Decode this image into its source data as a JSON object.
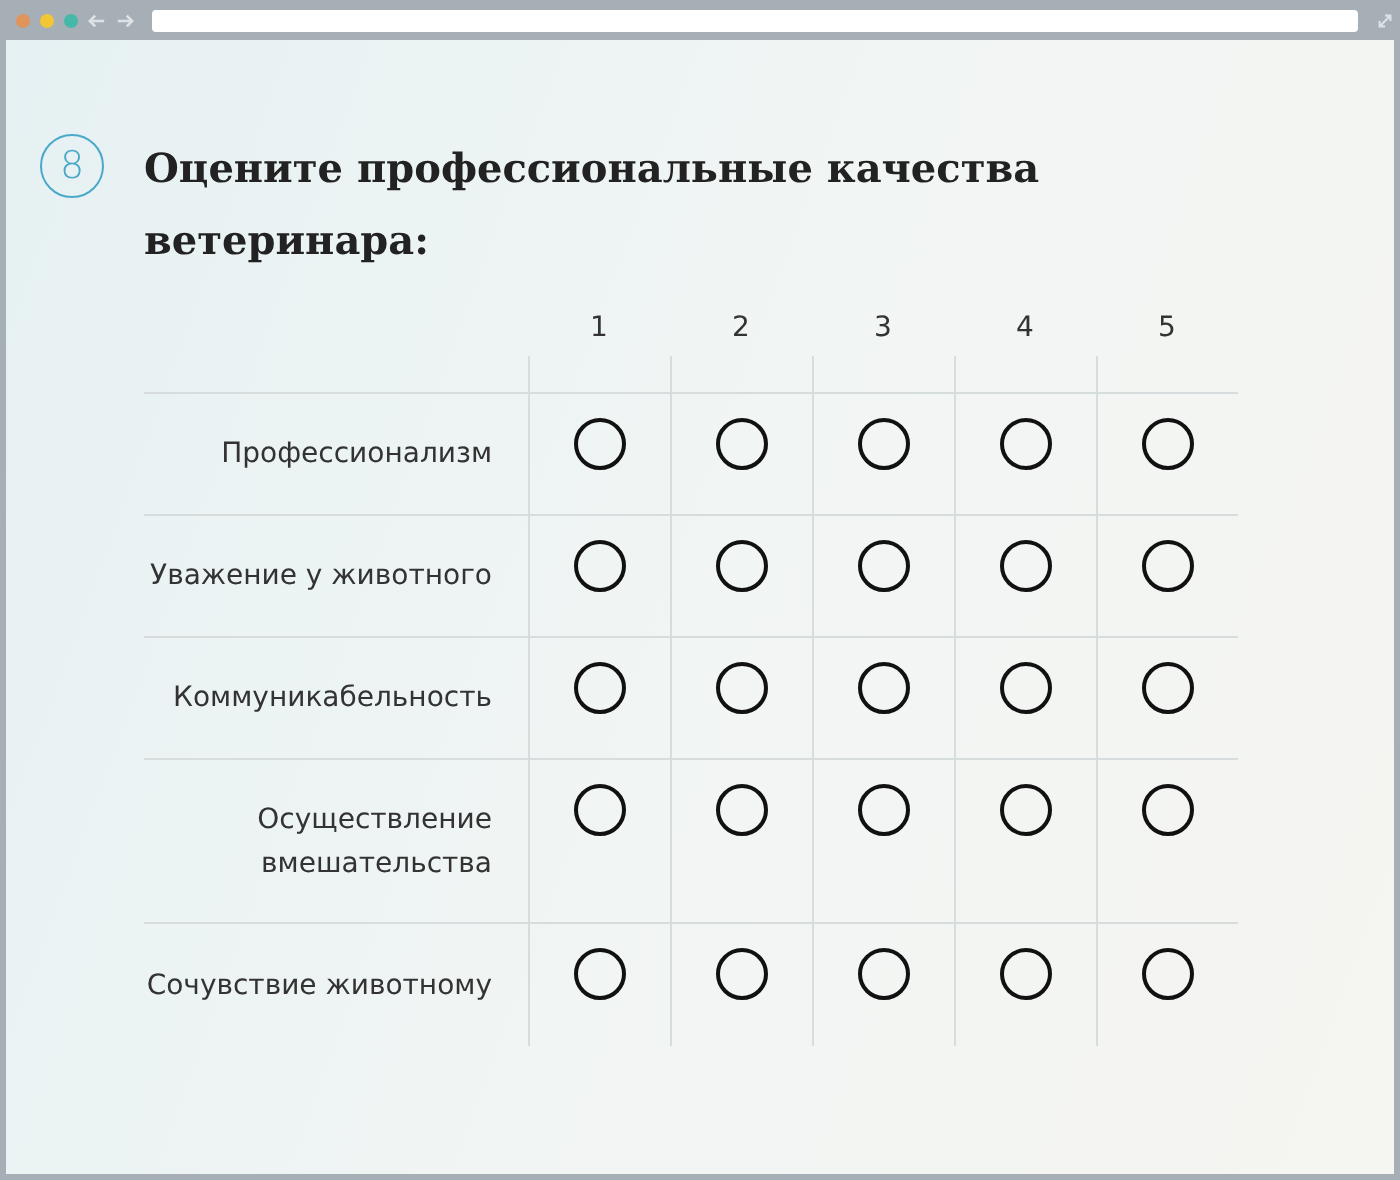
{
  "question": {
    "number": "8",
    "title": "Оцените профессиональные качества ветеринара:"
  },
  "scale": [
    "1",
    "2",
    "3",
    "4",
    "5"
  ],
  "rows": [
    {
      "label": "Профессионализм",
      "options": [
        {
          "selected": false
        },
        {
          "selected": false
        },
        {
          "selected": false
        },
        {
          "selected": false
        },
        {
          "selected": false
        }
      ]
    },
    {
      "label": "Уважение у животного",
      "options": [
        {
          "selected": false
        },
        {
          "selected": false
        },
        {
          "selected": false
        },
        {
          "selected": false
        },
        {
          "selected": false
        }
      ]
    },
    {
      "label": "Коммуникабельность",
      "options": [
        {
          "selected": false
        },
        {
          "selected": false
        },
        {
          "selected": false
        },
        {
          "selected": false
        },
        {
          "selected": false
        }
      ]
    },
    {
      "label": "Осуществление вмешательства",
      "options": [
        {
          "selected": false
        },
        {
          "selected": false
        },
        {
          "selected": false
        },
        {
          "selected": false
        },
        {
          "selected": false
        }
      ]
    },
    {
      "label": "Сочувствие животному",
      "options": [
        {
          "selected": false
        },
        {
          "selected": false
        },
        {
          "selected": false
        },
        {
          "selected": false
        },
        {
          "selected": false
        }
      ]
    }
  ]
}
